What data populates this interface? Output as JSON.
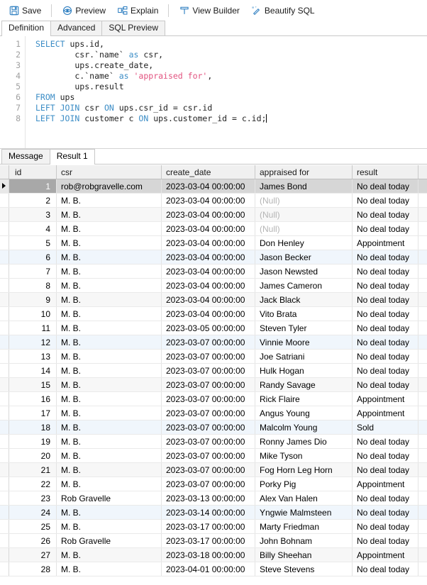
{
  "toolbar": {
    "buttons": [
      {
        "label": "Save",
        "icon": "save-icon"
      },
      {
        "label": "Preview",
        "icon": "preview-eye-icon"
      },
      {
        "label": "Explain",
        "icon": "explain-plan-icon"
      },
      {
        "label": "View Builder",
        "icon": "view-builder-icon"
      },
      {
        "label": "Beautify SQL",
        "icon": "beautify-sql-icon"
      }
    ],
    "separator_after_index": [
      0,
      2
    ]
  },
  "editor_tabs": {
    "items": [
      {
        "label": "Definition",
        "active": true
      },
      {
        "label": "Advanced",
        "active": false
      },
      {
        "label": "SQL Preview",
        "active": false
      }
    ]
  },
  "editor": {
    "line_numbers": [
      "1",
      "2",
      "3",
      "4",
      "5",
      "6",
      "7",
      "8"
    ],
    "lines": [
      [
        {
          "t": "SELECT",
          "c": "kw"
        },
        {
          "t": " ups.id,",
          "c": ""
        }
      ],
      [
        {
          "t": "        csr.`name` ",
          "c": ""
        },
        {
          "t": "as",
          "c": "kw"
        },
        {
          "t": " csr,",
          "c": ""
        }
      ],
      [
        {
          "t": "        ups.create_date,",
          "c": ""
        }
      ],
      [
        {
          "t": "        c.`name` ",
          "c": ""
        },
        {
          "t": "as",
          "c": "kw"
        },
        {
          "t": " ",
          "c": ""
        },
        {
          "t": "'appraised for'",
          "c": "str"
        },
        {
          "t": ",",
          "c": ""
        }
      ],
      [
        {
          "t": "        ups.result",
          "c": ""
        }
      ],
      [
        {
          "t": "FROM",
          "c": "kw"
        },
        {
          "t": " ups",
          "c": ""
        }
      ],
      [
        {
          "t": "LEFT JOIN",
          "c": "kw"
        },
        {
          "t": " csr ",
          "c": ""
        },
        {
          "t": "ON",
          "c": "kw"
        },
        {
          "t": " ups.csr_id = csr.id",
          "c": ""
        }
      ],
      [
        {
          "t": "LEFT JOIN",
          "c": "kw"
        },
        {
          "t": " customer c ",
          "c": ""
        },
        {
          "t": "ON",
          "c": "kw"
        },
        {
          "t": " ups.customer_id = c.id;",
          "c": ""
        }
      ]
    ]
  },
  "result_tabs": {
    "items": [
      {
        "label": "Message",
        "active": false
      },
      {
        "label": "Result 1",
        "active": true
      }
    ]
  },
  "grid": {
    "columns": [
      "id",
      "csr",
      "create_date",
      "appraised for",
      "result"
    ],
    "null_text": "(Null)",
    "rows": [
      {
        "id": "1",
        "csr": "rob@robgravelle.com",
        "create_date": "2023-03-04 00:00:00",
        "appraised_for": "James Bond",
        "result": "No deal today",
        "selected": true
      },
      {
        "id": "2",
        "csr": "M. B.",
        "create_date": "2023-03-04 00:00:00",
        "appraised_for": null,
        "result": "No deal today"
      },
      {
        "id": "3",
        "csr": "M. B.",
        "create_date": "2023-03-04 00:00:00",
        "appraised_for": null,
        "result": "No deal today"
      },
      {
        "id": "4",
        "csr": "M. B.",
        "create_date": "2023-03-04 00:00:00",
        "appraised_for": null,
        "result": "No deal today"
      },
      {
        "id": "5",
        "csr": "M. B.",
        "create_date": "2023-03-04 00:00:00",
        "appraised_for": "Don Henley",
        "result": "Appointment"
      },
      {
        "id": "6",
        "csr": "M. B.",
        "create_date": "2023-03-04 00:00:00",
        "appraised_for": "Jason Becker",
        "result": "No deal today"
      },
      {
        "id": "7",
        "csr": "M. B.",
        "create_date": "2023-03-04 00:00:00",
        "appraised_for": "Jason Newsted",
        "result": "No deal today"
      },
      {
        "id": "8",
        "csr": "M. B.",
        "create_date": "2023-03-04 00:00:00",
        "appraised_for": "James Cameron",
        "result": "No deal today"
      },
      {
        "id": "9",
        "csr": "M. B.",
        "create_date": "2023-03-04 00:00:00",
        "appraised_for": "Jack Black",
        "result": "No deal today"
      },
      {
        "id": "10",
        "csr": "M. B.",
        "create_date": "2023-03-04 00:00:00",
        "appraised_for": "Vito Brata",
        "result": "No deal today"
      },
      {
        "id": "11",
        "csr": "M. B.",
        "create_date": "2023-03-05 00:00:00",
        "appraised_for": "Steven Tyler",
        "result": "No deal today"
      },
      {
        "id": "12",
        "csr": "M. B.",
        "create_date": "2023-03-07 00:00:00",
        "appraised_for": "Vinnie Moore",
        "result": "No deal today"
      },
      {
        "id": "13",
        "csr": "M. B.",
        "create_date": "2023-03-07 00:00:00",
        "appraised_for": "Joe Satriani",
        "result": "No deal today"
      },
      {
        "id": "14",
        "csr": "M. B.",
        "create_date": "2023-03-07 00:00:00",
        "appraised_for": "Hulk Hogan",
        "result": "No deal today"
      },
      {
        "id": "15",
        "csr": "M. B.",
        "create_date": "2023-03-07 00:00:00",
        "appraised_for": "Randy Savage",
        "result": "No deal today"
      },
      {
        "id": "16",
        "csr": "M. B.",
        "create_date": "2023-03-07 00:00:00",
        "appraised_for": "Rick Flaire",
        "result": "Appointment"
      },
      {
        "id": "17",
        "csr": "M. B.",
        "create_date": "2023-03-07 00:00:00",
        "appraised_for": "Angus Young",
        "result": "Appointment"
      },
      {
        "id": "18",
        "csr": "M. B.",
        "create_date": "2023-03-07 00:00:00",
        "appraised_for": "Malcolm Young",
        "result": "Sold"
      },
      {
        "id": "19",
        "csr": "M. B.",
        "create_date": "2023-03-07 00:00:00",
        "appraised_for": "Ronny James Dio",
        "result": "No deal today"
      },
      {
        "id": "20",
        "csr": "M. B.",
        "create_date": "2023-03-07 00:00:00",
        "appraised_for": "Mike Tyson",
        "result": "No deal today"
      },
      {
        "id": "21",
        "csr": "M. B.",
        "create_date": "2023-03-07 00:00:00",
        "appraised_for": "Fog Horn Leg Horn",
        "result": "No deal today"
      },
      {
        "id": "22",
        "csr": "M. B.",
        "create_date": "2023-03-07 00:00:00",
        "appraised_for": "Porky Pig",
        "result": "Appointment"
      },
      {
        "id": "23",
        "csr": "Rob Gravelle",
        "create_date": "2023-03-13 00:00:00",
        "appraised_for": "Alex Van Halen",
        "result": "No deal today"
      },
      {
        "id": "24",
        "csr": "M. B.",
        "create_date": "2023-03-14 00:00:00",
        "appraised_for": "Yngwie Malmsteen",
        "result": "No deal today"
      },
      {
        "id": "25",
        "csr": "M. B.",
        "create_date": "2023-03-17 00:00:00",
        "appraised_for": "Marty Friedman",
        "result": "No deal today"
      },
      {
        "id": "26",
        "csr": "Rob Gravelle",
        "create_date": "2023-03-17 00:00:00",
        "appraised_for": "John Bohnam",
        "result": "No deal today"
      },
      {
        "id": "27",
        "csr": "M. B.",
        "create_date": "2023-03-18 00:00:00",
        "appraised_for": "Billy Sheehan",
        "result": "Appointment"
      },
      {
        "id": "28",
        "csr": "M. B.",
        "create_date": "2023-04-01 00:00:00",
        "appraised_for": "Steve Stevens",
        "result": "No deal today"
      }
    ]
  },
  "colors": {
    "accent": "#3c8dc6",
    "string_literal": "#e2527f",
    "selection": "#d6d6d6",
    "alt_row_blue": "#f0f6fc",
    "alt_row_gray": "#f7f7f7"
  }
}
